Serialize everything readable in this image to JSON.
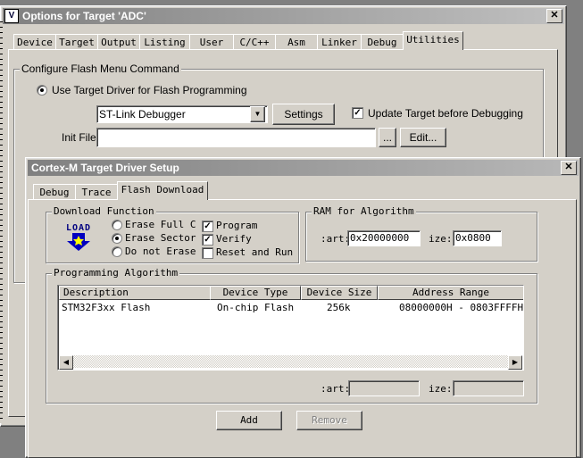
{
  "options_window": {
    "title": "Options for Target 'ADC'",
    "close_glyph": "✕",
    "icon_glyph": "V",
    "tabs": [
      "Device",
      "Target",
      "Output",
      "Listing",
      "User",
      "C/C++",
      "Asm",
      "Linker",
      "Debug",
      "Utilities"
    ],
    "selected_tab": "Utilities",
    "group_title": "Configure Flash Menu Command",
    "use_target_driver_label": "Use Target Driver for Flash Programming",
    "driver_select_value": "ST-Link Debugger",
    "settings_button": "Settings",
    "update_target_label": "Update Target before Debugging",
    "update_target_checked": true,
    "init_file_label": "Init File:",
    "init_file_value": "",
    "browse_button": "...",
    "edit_button": "Edit..."
  },
  "driver_window": {
    "title": "Cortex-M Target Driver Setup",
    "close_glyph": "✕",
    "tabs": [
      "Debug",
      "Trace",
      "Flash Download"
    ],
    "selected_tab": "Flash Download",
    "download_function": {
      "title": "Download Function",
      "load_icon_text": "LOAD",
      "erase_full": "Erase Full C",
      "erase_sector": "Erase Sector",
      "do_not_erase": "Do not Erase",
      "selected_erase": "Erase Sector",
      "program": "Program",
      "verify": "Verify",
      "reset_and_run": "Reset and Run",
      "program_checked": true,
      "verify_checked": true,
      "reset_checked": false,
      "check_glyph": "✓"
    },
    "ram": {
      "title": "RAM for Algorithm",
      "start_label": ":art:",
      "start_value": "0x20000000",
      "size_label": "ize:",
      "size_value": "0x0800"
    },
    "algorithm": {
      "title": "Programming Algorithm",
      "columns": [
        "Description",
        "Device Type",
        "Device Size",
        "Address Range"
      ],
      "rows": [
        {
          "description": "STM32F3xx Flash",
          "device_type": "On-chip Flash",
          "device_size": "256k",
          "address_range": "08000000H - 0803FFFFH"
        }
      ],
      "start_label": ":art:",
      "start_value": "",
      "size_label": "ize:",
      "size_value": "",
      "scroll_left_glyph": "◀",
      "scroll_right_glyph": "▶"
    },
    "add_button": "Add",
    "remove_button": "Remove"
  },
  "colors": {
    "inactive_title": "#808080",
    "face": "#d4d0c8"
  }
}
